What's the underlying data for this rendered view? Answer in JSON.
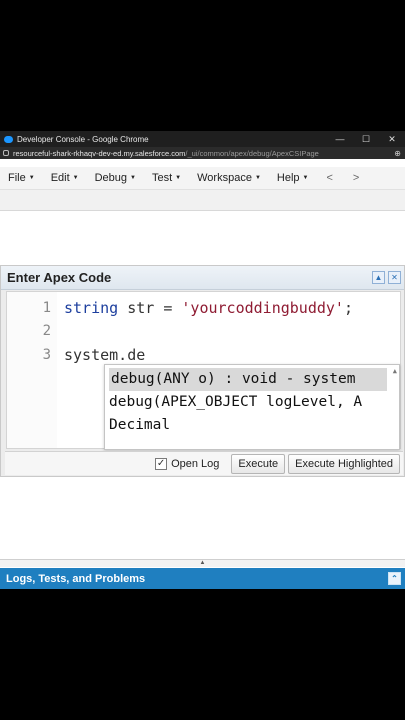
{
  "window": {
    "title": "Developer Console - Google Chrome",
    "controls": [
      "—",
      "☐",
      "✕"
    ],
    "url_host": "resourceful-shark-rkhaqv-dev-ed.my.salesforce.com",
    "url_path": "/_ui/common/apex/debug/ApexCSIPage"
  },
  "menu": {
    "items": [
      "File",
      "Edit",
      "Debug",
      "Test",
      "Workspace",
      "Help"
    ],
    "nav_back": "<",
    "nav_forward": ">"
  },
  "dialog": {
    "title": "Enter Apex Code",
    "collapse_glyph": "▲",
    "close_glyph": "✕",
    "line_numbers": [
      "1",
      "2",
      "3"
    ],
    "code": {
      "line1_keyword": "string",
      "line1_middle": " str = ",
      "line1_string": "'yourcoddingbuddy'",
      "line1_end": ";",
      "line3": "system.de"
    },
    "autocomplete": [
      "debug(ANY o) : void - system",
      "debug(APEX_OBJECT logLevel, A",
      "Decimal"
    ],
    "autocomplete_scroll_glyph": "▲",
    "open_log_label": "Open Log",
    "open_log_checked": true,
    "check_glyph": "✓",
    "execute_label": "Execute",
    "execute_highlighted_label": "Execute Highlighted"
  },
  "bottom_panel": {
    "splitter_glyph": "▲",
    "title": "Logs, Tests, and Problems",
    "expand_glyph": "⌃"
  },
  "colors": {
    "accent": "#1f7fc0",
    "keyword": "#1d3f9e",
    "string": "#8f1c33"
  }
}
